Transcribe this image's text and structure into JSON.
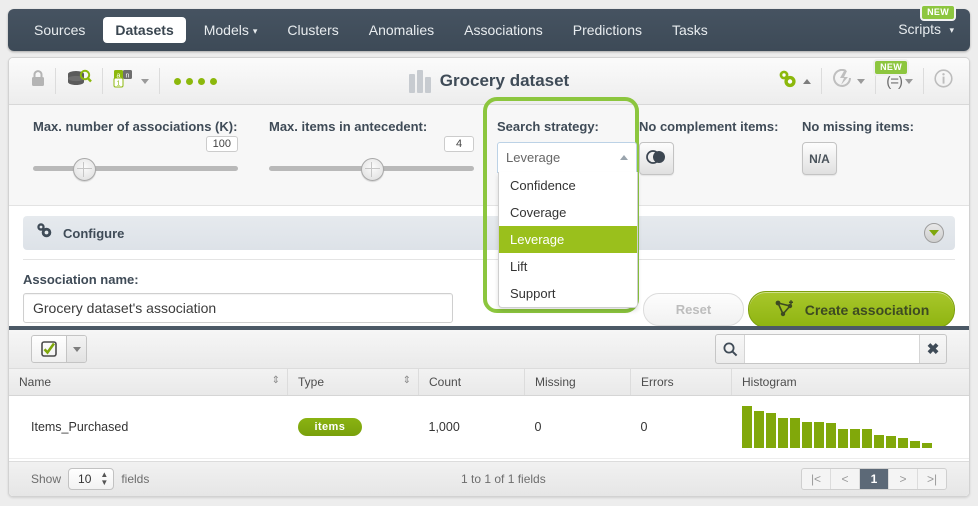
{
  "nav": {
    "items": [
      {
        "label": "Sources",
        "active": false,
        "caret": false
      },
      {
        "label": "Datasets",
        "active": true,
        "caret": false
      },
      {
        "label": "Models",
        "active": false,
        "caret": true
      },
      {
        "label": "Clusters",
        "active": false,
        "caret": false
      },
      {
        "label": "Anomalies",
        "active": false,
        "caret": false
      },
      {
        "label": "Associations",
        "active": false,
        "caret": false
      },
      {
        "label": "Predictions",
        "active": false,
        "caret": false
      },
      {
        "label": "Tasks",
        "active": false,
        "caret": false
      }
    ],
    "right_label": "Scripts",
    "right_badge": "NEW"
  },
  "header": {
    "title": "Grocery dataset",
    "lock_icon": "lock-icon",
    "source_icon": "database-search-icon",
    "fields_icon": "field-types-icon",
    "status_dots": 4,
    "gear_icon": "gears-icon",
    "flash_icon": "lightning-icon",
    "formula_label": "(=)",
    "formula_badge": "NEW",
    "info_icon": "info-icon"
  },
  "params": {
    "k": {
      "label": "Max. number of associations (K):",
      "value": "100",
      "percent": 22
    },
    "antecedent": {
      "label": "Max. items in antecedent:",
      "value": "4",
      "percent": 50
    },
    "strategy": {
      "label": "Search strategy:",
      "selected": "Leverage",
      "options": [
        "Confidence",
        "Coverage",
        "Leverage",
        "Lift",
        "Support"
      ]
    },
    "no_complement": {
      "label": "No complement items:",
      "icon": "toggle-icon"
    },
    "no_missing": {
      "label": "No missing items:",
      "value": "N/A"
    }
  },
  "configure": {
    "label": "Configure",
    "expand_icon": "chevron-down-icon"
  },
  "association": {
    "name_label": "Association name:",
    "name_value": "Grocery dataset's association",
    "reset_label": "Reset",
    "create_label": "Create association",
    "create_icon": "association-graph-icon"
  },
  "fields": {
    "select_icon": "checkbox-checked-icon",
    "search_placeholder": "",
    "search_value": "",
    "search_icon": "search-icon",
    "clear_icon": "close-icon",
    "columns": [
      "Name",
      "Type",
      "Count",
      "Missing",
      "Errors",
      "Histogram"
    ],
    "sortable": [
      "Name",
      "Type"
    ],
    "rows": [
      {
        "name": "Items_Purchased",
        "type": "items",
        "count": "1,000",
        "missing": "0",
        "errors": "0"
      }
    ],
    "histogram": [
      100,
      88,
      84,
      72,
      72,
      62,
      62,
      60,
      46,
      45,
      46,
      30,
      28,
      24,
      16,
      12
    ],
    "footer": {
      "show_label": "Show",
      "page_size": "10",
      "fields_label": "fields",
      "range_label": "1 to 1 of 1 fields",
      "pager": [
        "|<",
        "<",
        "1",
        ">",
        ">|"
      ],
      "current_page": "1"
    }
  },
  "colors": {
    "accent": "#8cb80c",
    "nav_bg": "#3f4c59",
    "highlight": "#9ac01c"
  }
}
